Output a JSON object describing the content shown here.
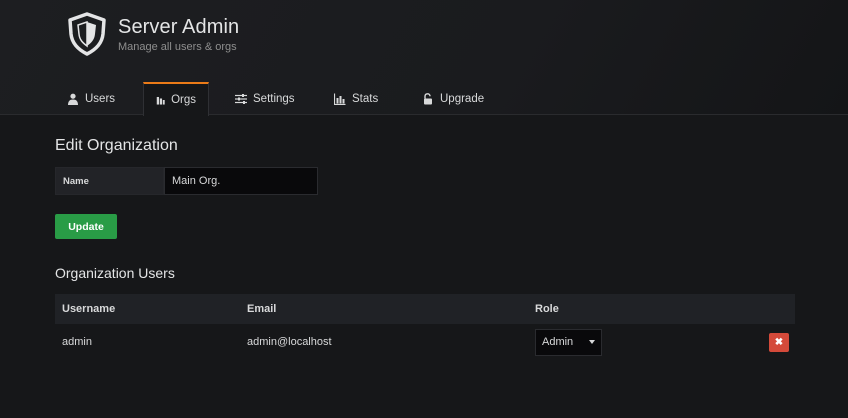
{
  "header": {
    "title": "Server Admin",
    "subtitle": "Manage all users & orgs"
  },
  "tabs": [
    {
      "label": "Users",
      "icon": "user-icon",
      "active": false
    },
    {
      "label": "Orgs",
      "icon": "building-icon",
      "active": true
    },
    {
      "label": "Settings",
      "icon": "sliders-icon",
      "active": false
    },
    {
      "label": "Stats",
      "icon": "bar-chart-icon",
      "active": false
    },
    {
      "label": "Upgrade",
      "icon": "unlock-icon",
      "active": false
    }
  ],
  "edit_org": {
    "title": "Edit Organization",
    "name_label": "Name",
    "name_value": "Main Org.",
    "update_label": "Update"
  },
  "org_users": {
    "title": "Organization Users",
    "columns": {
      "username": "Username",
      "email": "Email",
      "role": "Role"
    },
    "rows": [
      {
        "username": "admin",
        "email": "admin@localhost",
        "role": "Admin"
      }
    ],
    "remove_label": "✖"
  },
  "colors": {
    "accent": "#eb7b18",
    "success": "#299c46",
    "danger": "#d44a3a",
    "background": "#161719"
  }
}
